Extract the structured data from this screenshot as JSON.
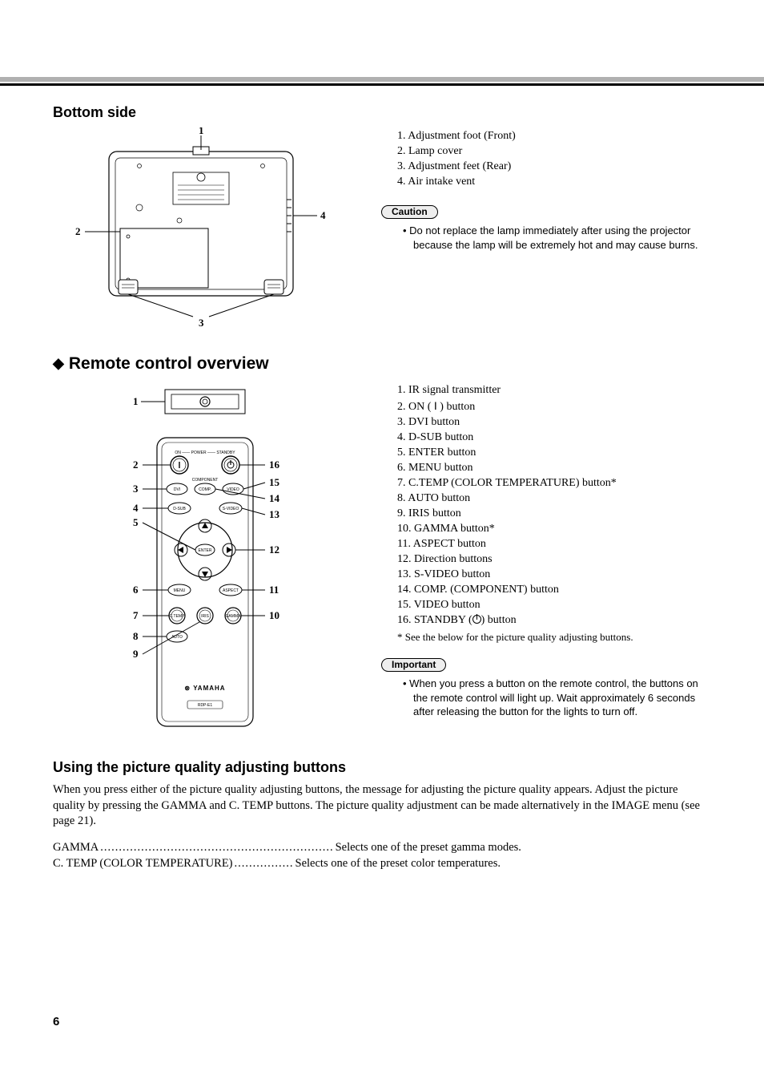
{
  "page_number": "6",
  "bottom_side": {
    "heading": "Bottom side",
    "callouts": [
      "1",
      "2",
      "3",
      "4"
    ],
    "list": [
      "1.   Adjustment foot (Front)",
      "2.   Lamp cover",
      "3.   Adjustment feet (Rear)",
      "4.   Air intake vent"
    ],
    "caution_label": "Caution",
    "caution_text": "Do not replace the lamp immediately after using the projector because the lamp will be extremely hot and may cause burns."
  },
  "remote": {
    "heading": "Remote control overview",
    "left_callouts": [
      "1",
      "2",
      "3",
      "4",
      "5",
      "6",
      "7",
      "8",
      "9"
    ],
    "right_callouts": [
      "16",
      "15",
      "14",
      "13",
      "12",
      "11",
      "10"
    ],
    "list": [
      "1.   IR signal transmitter",
      "2.   ON ( I ) button",
      "3.   DVI button",
      "4.   D-SUB button",
      "5.   ENTER button",
      "6.   MENU button",
      "7.   C.TEMP (COLOR TEMPERATURE) button*",
      "8.   AUTO button",
      "9.   IRIS button",
      "10. GAMMA button*",
      "11. ASPECT button",
      "12. Direction buttons",
      "13. S-VIDEO button",
      "14. COMP. (COMPONENT) button",
      "15. VIDEO button",
      "16. STANDBY (   ) button"
    ],
    "footnote": "* See the below for the picture quality adjusting buttons.",
    "important_label": "Important",
    "important_text": "When you press a button on the remote control, the buttons on the remote control will light up. Wait approximately 6 seconds after releasing the button for the lights to turn off."
  },
  "adjusting": {
    "heading": "Using the picture quality adjusting buttons",
    "body": "When you press either of the picture quality adjusting buttons, the message for adjusting the picture quality appears. Adjust the picture quality by pressing the GAMMA and C. TEMP buttons. The picture quality adjustment can be made alternatively in the IMAGE menu (see page 21).",
    "rows": [
      {
        "term": "GAMMA",
        "dots": "...............................................................",
        "desc": "Selects one of the preset gamma modes."
      },
      {
        "term": "C. TEMP (COLOR TEMPERATURE)",
        "dots": "................",
        "desc": "Selects one of the preset color temperatures."
      }
    ]
  },
  "remote_labels": {
    "on_power_standby": "ON —— POWER —— STANDBY",
    "component": "COMPONENT",
    "dvi": "DVI",
    "comp": "COMP.",
    "video": "VIDEO",
    "dsub": "D-SUB",
    "svideo": "S-VIDEO",
    "enter": "ENTER",
    "menu": "MENU",
    "aspect": "ASPECT",
    "ctemp": "C.TEMP",
    "iris": "IRIS",
    "gamma": "GAMMA",
    "auto": "AUTO",
    "brand": "YAMAHA",
    "model": "RDP-E1"
  }
}
